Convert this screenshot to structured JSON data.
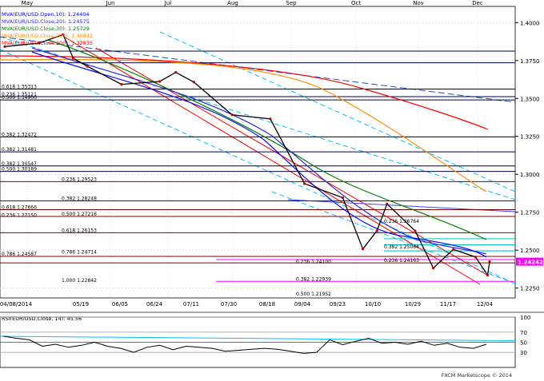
{
  "chart_data": {
    "type": "line",
    "title": "",
    "months": [
      "May",
      "Jun",
      "Jul",
      "Aug",
      "Sep",
      "Oct",
      "Nov",
      "Dec"
    ],
    "x_dates": [
      "04/08/2014",
      "05/19",
      "06/05",
      "06/24",
      "07/11",
      "07/30",
      "08/18",
      "09/04",
      "09/23",
      "10/10",
      "10/29",
      "11/17",
      "12/04"
    ],
    "price_axis": {
      "range": [
        1.22,
        1.41
      ],
      "ticks": [
        "1.4000",
        "1.3750",
        "1.3500",
        "1.3250",
        "1.3000",
        "1.2750",
        "1.2500",
        "1.2250"
      ],
      "last_price": "1.24242",
      "grid": true
    },
    "legend": [
      {
        "text": "MVA(EUR/USD.Open,10): 1.24404",
        "color": "#0000ff"
      },
      {
        "text": "MVA(EUR/USD.Close,20): 1.24575",
        "color": "#3030d0"
      },
      {
        "text": "MVA(EUR/USD.Close,30): 1.25729",
        "color": "#008000"
      },
      {
        "text": "MVA(EUR/USD.Close,200): 1.30832",
        "color": "#ff8c00"
      },
      {
        "text": "MVA(EUR/USD.Close,200): 1.32835",
        "color": "#ff0000"
      }
    ],
    "level_labels": [
      {
        "text": "0.618 1.35313",
        "price": 1.3562
      },
      {
        "text": "0.236 1.35121",
        "price": 1.3512
      },
      {
        "text": "0.500 1.34900",
        "price": 1.349
      },
      {
        "text": "0.382 1.32472",
        "price": 1.3247
      },
      {
        "text": "0.382 1.31481",
        "price": 1.3148
      },
      {
        "text": "0.382 1.30547",
        "price": 1.3055
      },
      {
        "text": "0.500 1.30189",
        "price": 1.3019
      },
      {
        "text": "0.236 1.29523",
        "price": 1.2952
      },
      {
        "text": "0.382 1.28248",
        "price": 1.2825
      },
      {
        "text": "0.618 1.27666",
        "price": 1.2767
      },
      {
        "text": "0.236 1.27150",
        "price": 1.2715
      },
      {
        "text": "0.500 1.27216",
        "price": 1.2722
      },
      {
        "text": "0.618 1.26153",
        "price": 1.2615
      },
      {
        "text": "0.382 1.25064",
        "price": 1.2506
      },
      {
        "text": "0.786 1.24587",
        "price": 1.2459
      },
      {
        "text": "0.786 1.24714",
        "price": 1.2471
      },
      {
        "text": "0.236 1.24100",
        "price": 1.241
      },
      {
        "text": "0.236 1.24163",
        "price": 1.2416
      },
      {
        "text": "1.000 1.22842",
        "price": 1.2284
      },
      {
        "text": "0.382 1.22939",
        "price": 1.2294
      },
      {
        "text": "0.500 1.21952",
        "price": 1.2195
      },
      {
        "text": "0.236 1.26764",
        "price": 1.2676
      }
    ],
    "horizontal_levels": [
      1.3812,
      1.3735,
      1.3562,
      1.3512,
      1.349,
      1.3247,
      1.3148,
      1.3055,
      1.3019,
      1.2952,
      1.2825,
      1.2767,
      1.2722,
      1.2615,
      1.2459,
      1.2416
    ],
    "magenta_levels": [
      1.2438,
      1.2294
    ],
    "price_series": [
      {
        "date": "2014-04-08",
        "close": 1.3842
      },
      {
        "date": "2014-04-25",
        "close": 1.3865
      },
      {
        "date": "2014-05-07",
        "close": 1.3921
      },
      {
        "date": "2014-05-12",
        "close": 1.3765
      },
      {
        "date": "2014-05-19",
        "close": 1.3712
      },
      {
        "date": "2014-06-05",
        "close": 1.3593
      },
      {
        "date": "2014-06-24",
        "close": 1.3612
      },
      {
        "date": "2014-07-02",
        "close": 1.3672
      },
      {
        "date": "2014-07-11",
        "close": 1.3608
      },
      {
        "date": "2014-07-30",
        "close": 1.3392
      },
      {
        "date": "2014-08-18",
        "close": 1.3365
      },
      {
        "date": "2014-09-04",
        "close": 1.2938
      },
      {
        "date": "2014-09-23",
        "close": 1.2846
      },
      {
        "date": "2014-10-03",
        "close": 1.2508
      },
      {
        "date": "2014-10-10",
        "close": 1.2628
      },
      {
        "date": "2014-10-15",
        "close": 1.2805
      },
      {
        "date": "2014-10-29",
        "close": 1.2627
      },
      {
        "date": "2014-11-07",
        "close": 1.2382
      },
      {
        "date": "2014-11-17",
        "close": 1.2505
      },
      {
        "date": "2014-11-28",
        "close": 1.2455
      },
      {
        "date": "2014-12-04",
        "close": 1.2335
      },
      {
        "date": "2014-12-05",
        "close": 1.2424
      }
    ],
    "rsi": {
      "label": "RSI(EUR/USD.Close, 14): 45.56",
      "range": [
        0,
        100
      ],
      "ticks": [
        "100",
        "70",
        "50",
        "30"
      ],
      "values": [
        62,
        58,
        55,
        42,
        46,
        40,
        44,
        50,
        42,
        38,
        30,
        40,
        44,
        35,
        42,
        40,
        38,
        32,
        34,
        36,
        38,
        36,
        32,
        28,
        30,
        55,
        45,
        52,
        58,
        48,
        50,
        46,
        52,
        44,
        48,
        40,
        38,
        46
      ]
    },
    "watermark": "FXCM Marketscope © 2014"
  }
}
